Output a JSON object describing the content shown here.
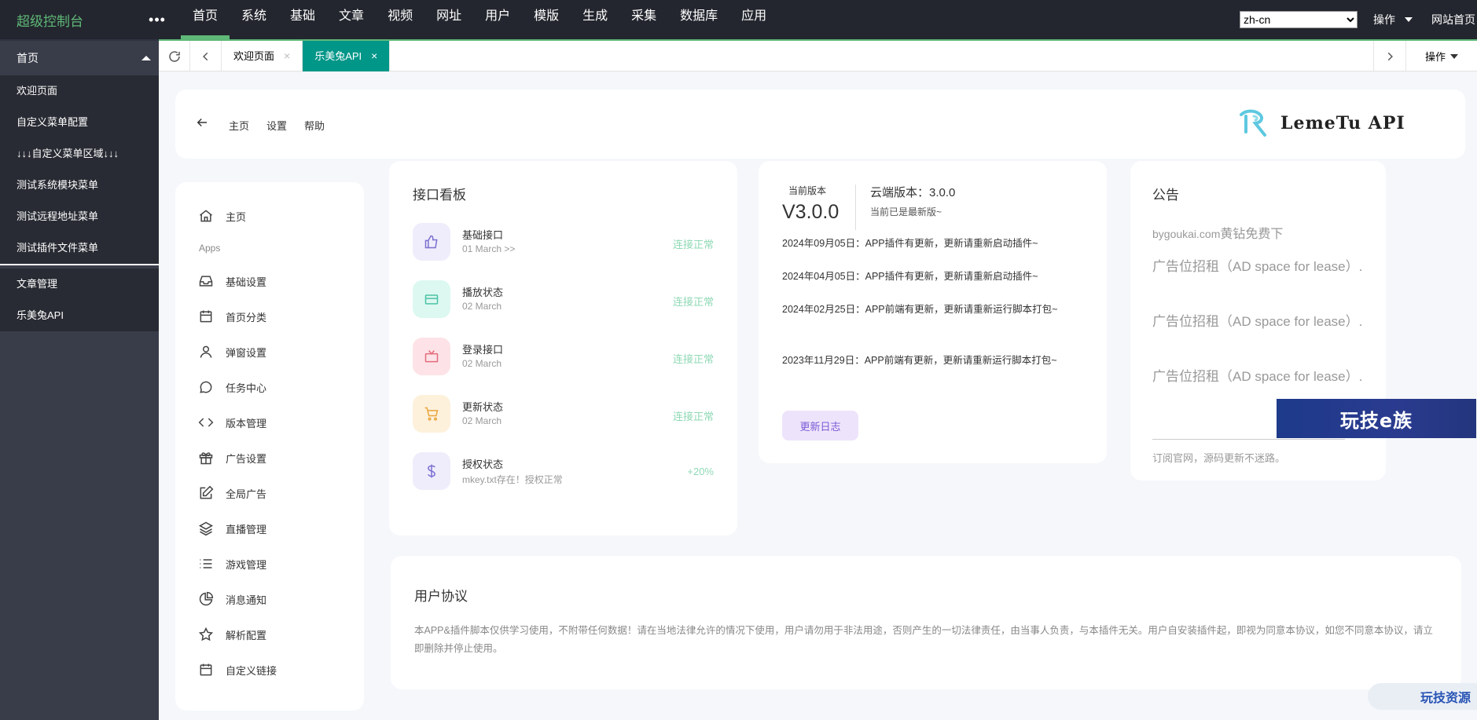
{
  "topbar": {
    "logo": "超级控制台",
    "more": "•••",
    "nav": [
      "首页",
      "系统",
      "基础",
      "文章",
      "视频",
      "网址",
      "用户",
      "模版",
      "生成",
      "采集",
      "数据库",
      "应用"
    ],
    "active_nav": "首页",
    "language": "zh-cn",
    "ops_label": "操作",
    "site_home": "网站首页"
  },
  "sidebar": {
    "group1_title": "首页",
    "group1_items": [
      "欢迎页面",
      "自定义菜单配置",
      "↓↓↓自定义菜单区域↓↓↓",
      "测试系统模块菜单",
      "测试远程地址菜单",
      "测试插件文件菜单"
    ],
    "group2_items": [
      "文章管理",
      "乐美兔API"
    ]
  },
  "tabbar": {
    "tabs": [
      {
        "label": "欢迎页面",
        "active": false
      },
      {
        "label": "乐美兔API",
        "active": true
      }
    ],
    "ops_label": "操作",
    "close_glyph": "×"
  },
  "header": {
    "links": [
      "主页",
      "设置",
      "帮助"
    ],
    "brand": "LemeTu API"
  },
  "menu": {
    "home": "主页",
    "apps_label": "Apps",
    "items": [
      {
        "label": "基础设置",
        "icon": "inbox-icon"
      },
      {
        "label": "首页分类",
        "icon": "calendar-icon"
      },
      {
        "label": "弹窗设置",
        "icon": "user-icon"
      },
      {
        "label": "任务中心",
        "icon": "chat-icon"
      },
      {
        "label": "版本管理",
        "icon": "code-icon"
      },
      {
        "label": "广告设置",
        "icon": "gift-icon"
      },
      {
        "label": "全局广告",
        "icon": "edit-icon"
      },
      {
        "label": "直播管理",
        "icon": "layers-icon"
      },
      {
        "label": "游戏管理",
        "icon": "list-icon"
      },
      {
        "label": "消息通知",
        "icon": "pie-icon"
      },
      {
        "label": "解析配置",
        "icon": "star-icon"
      },
      {
        "label": "自定义链接",
        "icon": "calendar-icon"
      }
    ]
  },
  "api_board": {
    "title": "接口看板",
    "rows": [
      {
        "name": "基础接口",
        "sub": "01 March >>",
        "status": "连接正常",
        "icon": "thumbs-up-icon",
        "color": "#7b6fd1",
        "bg": "#efedfb"
      },
      {
        "name": "播放状态",
        "sub": "02 March",
        "status": "连接正常",
        "icon": "card-icon",
        "color": "#4cc3a6",
        "bg": "#dcf8f1"
      },
      {
        "name": "登录接口",
        "sub": "02 March",
        "status": "连接正常",
        "icon": "tv-icon",
        "color": "#e46b7a",
        "bg": "#fde3e7"
      },
      {
        "name": "更新状态",
        "sub": "02 March",
        "status": "连接正常",
        "icon": "cart-icon",
        "color": "#e9a53a",
        "bg": "#fdf1dc"
      },
      {
        "name": "授权状态",
        "sub": "mkey.txt存在！授权正常",
        "status": "+20%",
        "icon": "dollar-icon",
        "color": "#7b6fd1",
        "bg": "#efedfb"
      }
    ]
  },
  "version": {
    "current_label": "当前版本",
    "current": "V3.0.0",
    "cloud_label": "云端版本：",
    "cloud": "3.0.0",
    "latest_msg": "当前已是最新版~",
    "logs": [
      "2024年09月05日：APP插件有更新，更新请重新启动插件~",
      "2024年04月05日：APP插件有更新，更新请重新启动插件~",
      "2024年02月25日：APP前端有更新，更新请重新运行脚本打包~",
      "2023年11月29日：APP前端有更新，更新请重新运行脚本打包~"
    ],
    "changelog_btn": "更新日志"
  },
  "notice": {
    "title": "公告",
    "bygoukai": "bygoukai.com",
    "bygoukai_suffix": "黄钻免费下",
    "ads": [
      "广告位招租（AD space for lease）.",
      "广告位招租（AD space for lease）.",
      "广告位招租（AD space for lease）."
    ],
    "footer": "订阅官网，源码更新不迷路。"
  },
  "banner": "玩技e族",
  "agreement": {
    "title": "用户协议",
    "text": "本APP&插件脚本仅供学习使用，不附带任何数据！请在当地法律允许的情况下使用，用户请勿用于非法用途，否则产生的一切法律责任，由当事人负责，与本插件无关。用户自安装插件起，即视为同意本协议，如您不同意本协议，请立即删除并停止使用。"
  },
  "watermark": "玩技资源"
}
